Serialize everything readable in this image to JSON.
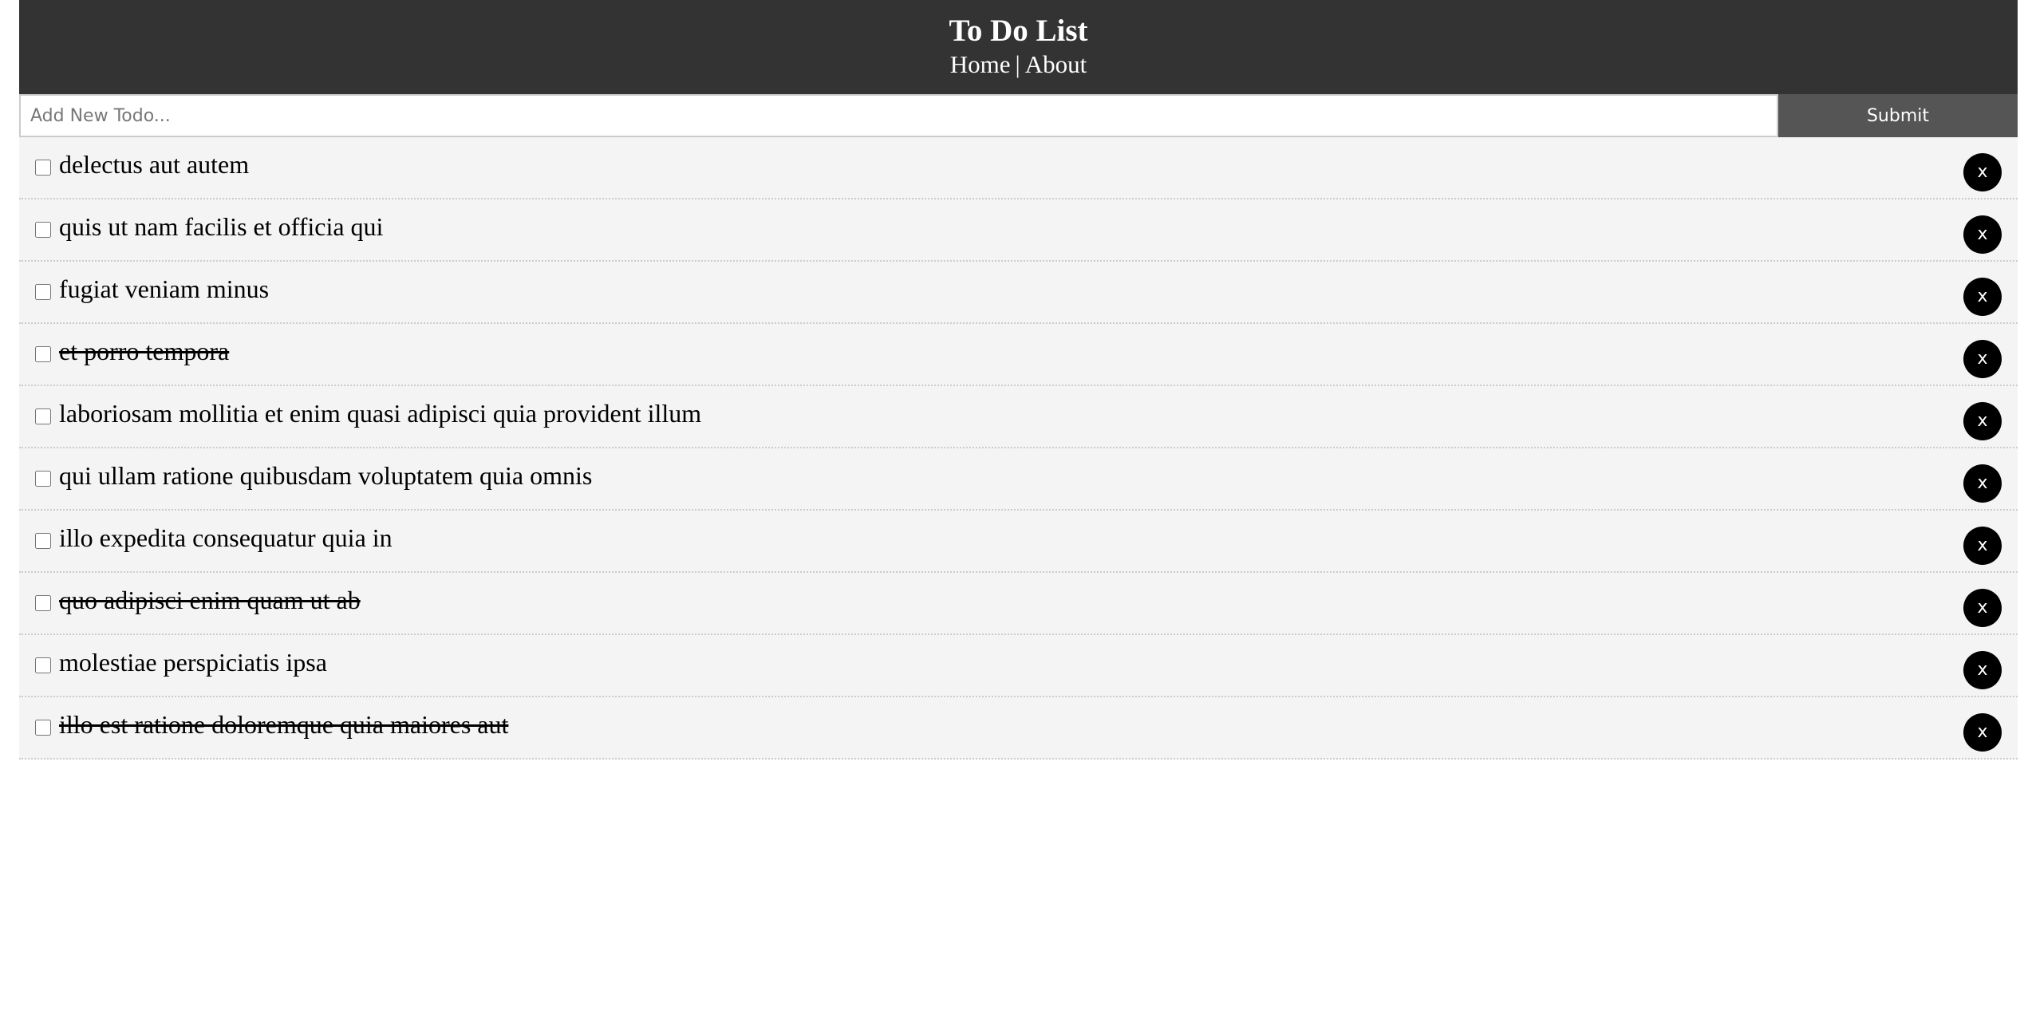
{
  "header": {
    "title": "To Do List",
    "nav": {
      "home": "Home",
      "separator": "|",
      "about": "About"
    }
  },
  "form": {
    "placeholder": "Add New Todo...",
    "value": "",
    "submit_label": "Submit"
  },
  "todos": [
    {
      "title": "delectus aut autem",
      "completed": false,
      "delete_label": "x"
    },
    {
      "title": "quis ut nam facilis et officia qui",
      "completed": false,
      "delete_label": "x"
    },
    {
      "title": "fugiat veniam minus",
      "completed": false,
      "delete_label": "x"
    },
    {
      "title": "et porro tempora",
      "completed": true,
      "delete_label": "x"
    },
    {
      "title": "laboriosam mollitia et enim quasi adipisci quia provident illum",
      "completed": false,
      "delete_label": "x"
    },
    {
      "title": "qui ullam ratione quibusdam voluptatem quia omnis",
      "completed": false,
      "delete_label": "x"
    },
    {
      "title": "illo expedita consequatur quia in",
      "completed": false,
      "delete_label": "x"
    },
    {
      "title": "quo adipisci enim quam ut ab",
      "completed": true,
      "delete_label": "x"
    },
    {
      "title": "molestiae perspiciatis ipsa",
      "completed": false,
      "delete_label": "x"
    },
    {
      "title": "illo est ratione doloremque quia maiores aut",
      "completed": true,
      "delete_label": "x"
    }
  ],
  "colors": {
    "header_bg": "#333333",
    "submit_bg": "#555555",
    "item_bg": "#f4f4f4",
    "delete_bg": "#000000"
  }
}
